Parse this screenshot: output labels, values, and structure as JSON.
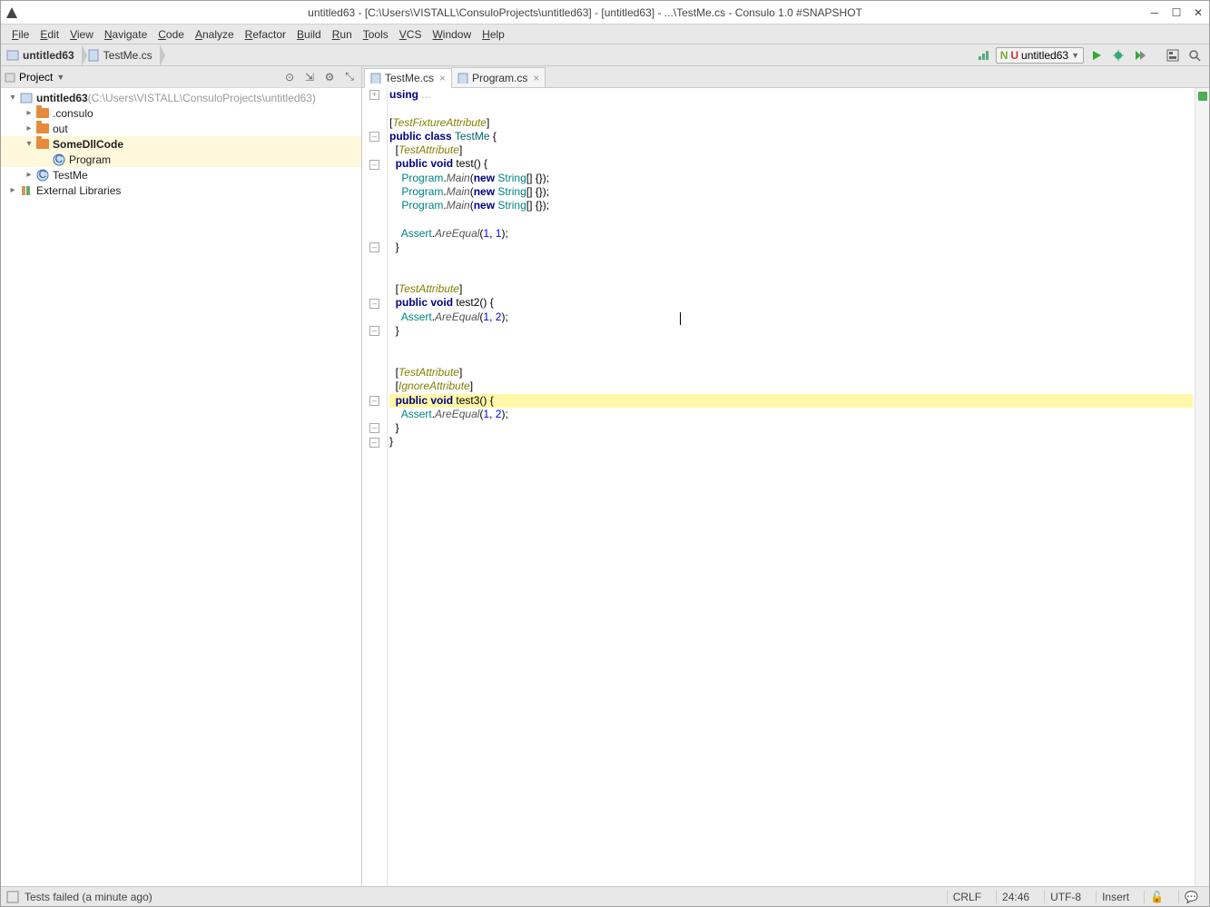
{
  "window": {
    "title": "untitled63 - [C:\\Users\\VISTALL\\ConsuloProjects\\untitled63] - [untitled63] - ...\\TestMe.cs - Consulo 1.0 #SNAPSHOT"
  },
  "menu": {
    "items": [
      "File",
      "Edit",
      "View",
      "Navigate",
      "Code",
      "Analyze",
      "Refactor",
      "Build",
      "Run",
      "Tools",
      "VCS",
      "Window",
      "Help"
    ]
  },
  "breadcrumb": {
    "items": [
      {
        "label": "untitled63",
        "bold": true
      },
      {
        "label": "TestMe.cs"
      }
    ]
  },
  "runconfig": {
    "label": "untitled63"
  },
  "sidebar": {
    "title": "Project",
    "tree": [
      {
        "depth": 0,
        "arrow": "▾",
        "icon": "module",
        "label": "untitled63",
        "bold": true,
        "suffix": "(C:\\Users\\VISTALL\\ConsuloProjects\\untitled63)"
      },
      {
        "depth": 1,
        "arrow": "▸",
        "icon": "folder",
        "label": ".consulo"
      },
      {
        "depth": 1,
        "arrow": "▸",
        "icon": "folder",
        "label": "out"
      },
      {
        "depth": 1,
        "arrow": "▾",
        "icon": "folder",
        "label": "SomeDllCode",
        "bold": true,
        "sel": true
      },
      {
        "depth": 2,
        "arrow": "",
        "icon": "csclass",
        "label": "Program",
        "sel": true
      },
      {
        "depth": 1,
        "arrow": "▸",
        "icon": "csclass",
        "label": "TestMe"
      },
      {
        "depth": 0,
        "arrow": "▸",
        "icon": "lib",
        "label": "External Libraries"
      }
    ]
  },
  "tabs": [
    {
      "label": "TestMe.cs",
      "active": true
    },
    {
      "label": "Program.cs",
      "active": false
    }
  ],
  "editor": {
    "lines": [
      {
        "t": "fold-plus",
        "html": "<span class='kw'>using</span> <span class='dim'>...</span>"
      },
      {
        "t": "blank"
      },
      {
        "t": "plain",
        "html": "[<span class='attr'>TestFixtureAttribute</span>]"
      },
      {
        "t": "fold-minus",
        "html": "<span class='kw'>public</span> <span class='kw'>class</span> <span class='cls'>TestMe</span> {"
      },
      {
        "t": "plain",
        "html": "  [<span class='attr'>TestAttribute</span>]"
      },
      {
        "t": "fold-minus",
        "html": "  <span class='kw'>public</span> <span class='kw'>void</span> test() {"
      },
      {
        "t": "plain",
        "html": "    <span class='type'>Program</span>.<span class='method'>Main</span>(<span class='kw'>new</span> <span class='type'>String</span>[] {});"
      },
      {
        "t": "plain",
        "html": "    <span class='type'>Program</span>.<span class='method'>Main</span>(<span class='kw'>new</span> <span class='type'>String</span>[] {});"
      },
      {
        "t": "plain",
        "html": "    <span class='type'>Program</span>.<span class='method'>Main</span>(<span class='kw'>new</span> <span class='type'>String</span>[] {});"
      },
      {
        "t": "blank"
      },
      {
        "t": "plain",
        "html": "    <span class='type'>Assert</span>.<span class='method'>AreEqual</span>(<span class='num'>1</span>, <span class='num'>1</span>);"
      },
      {
        "t": "end",
        "html": "  }"
      },
      {
        "t": "blank"
      },
      {
        "t": "blank"
      },
      {
        "t": "plain",
        "html": "  [<span class='attr'>TestAttribute</span>]"
      },
      {
        "t": "fold-minus",
        "html": "  <span class='kw'>public</span> <span class='kw'>void</span> test2() {"
      },
      {
        "t": "plain",
        "html": "    <span class='type'>Assert</span>.<span class='method'>AreEqual</span>(<span class='num'>1</span>, <span class='num'>2</span>);"
      },
      {
        "t": "end",
        "html": "  }"
      },
      {
        "t": "blank"
      },
      {
        "t": "blank"
      },
      {
        "t": "plain",
        "html": "  [<span class='attr'>TestAttribute</span>]"
      },
      {
        "t": "plain",
        "html": "  [<span class='attr'>IgnoreAttribute</span>]"
      },
      {
        "t": "fold-minus",
        "hl": true,
        "html": "  <span class='kw'>public</span> <span class='kw'>void</span> test3() {"
      },
      {
        "t": "plain",
        "html": "    <span class='type'>Assert</span>.<span class='method'>AreEqual</span>(<span class='num'>1</span>, <span class='num'>2</span>);"
      },
      {
        "t": "end",
        "html": "  }"
      },
      {
        "t": "end",
        "html": "}"
      }
    ],
    "caret": {
      "line": 16,
      "col": 46
    }
  },
  "status": {
    "message": "Tests failed (a minute ago)",
    "line_sep": "CRLF",
    "posn": "24:46",
    "encoding": "UTF-8",
    "insert": "Insert"
  }
}
